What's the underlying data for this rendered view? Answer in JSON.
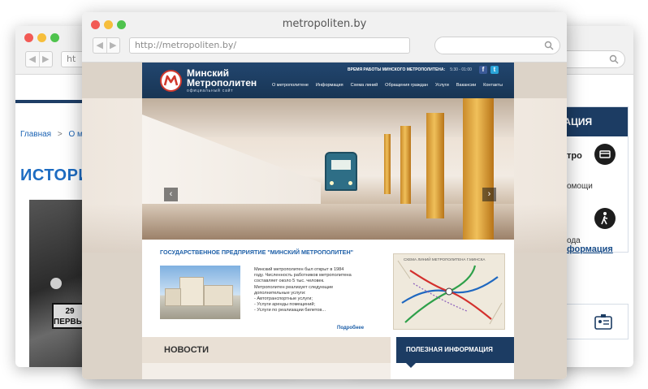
{
  "front_window": {
    "title": "metropoliten.by",
    "url": "http://metropoliten.by/"
  },
  "left_window": {
    "url_partial": "ht",
    "breadcrumb_home": "Главная",
    "breadcrumb_sep": ">",
    "breadcrumb_next": "О мет",
    "heading": "ИСТОРИ",
    "train_plate": [
      "29",
      "ПЕРВЫЙ"
    ]
  },
  "right_window": {
    "panel_title": "ФОРМАЦИЯ",
    "line1": "тро",
    "line2": "омощи",
    "line3": "ода",
    "link": "формация"
  },
  "site": {
    "brand_line1": "Минский",
    "brand_line2": "Метрополитен",
    "brand_sub": "официальный сайт",
    "hours_label": "ВРЕМЯ РАБОТЫ МИНСКОГО МЕТРОПОЛИТЕНА:",
    "hours_value": "5:30 - 01:00",
    "social": [
      "f",
      "t"
    ],
    "nav": [
      "О метрополитене",
      "Информация",
      "Схема линий",
      "Обращения граждан",
      "Услуги",
      "Вакансии",
      "Контакты"
    ],
    "hero_prev": "‹",
    "hero_next": "›",
    "section_title": "ГОСУДАРСТВЕННОЕ ПРЕДПРИЯТИЕ \"МИНСКИЙ МЕТРОПОЛИТЕН\"",
    "description_lines": [
      "Минский метрополитен был открыт в 1984",
      "году. Численность работников метрополитена",
      "составляет около 5 тыс. человек.",
      "Метрополитен реализует следующие",
      "дополнительные услуги:",
      "- Автотранспортные услуги;",
      "- Услуги аренды помещений;",
      "- Услуги по реализации билетов..."
    ],
    "more_link": "Подробнее",
    "map_title": "СХЕМА ЛИНИЙ МЕТРОПОЛИТЕНА Г.МИНСКА",
    "news_heading": "НОВОСТИ",
    "useful_heading": "ПОЛЕЗНАЯ ИНФОРМАЦИЯ"
  },
  "colors": {
    "header_navy": "#1c3c63",
    "link_blue": "#1d5fa8",
    "logo_red": "#d13a2e"
  }
}
